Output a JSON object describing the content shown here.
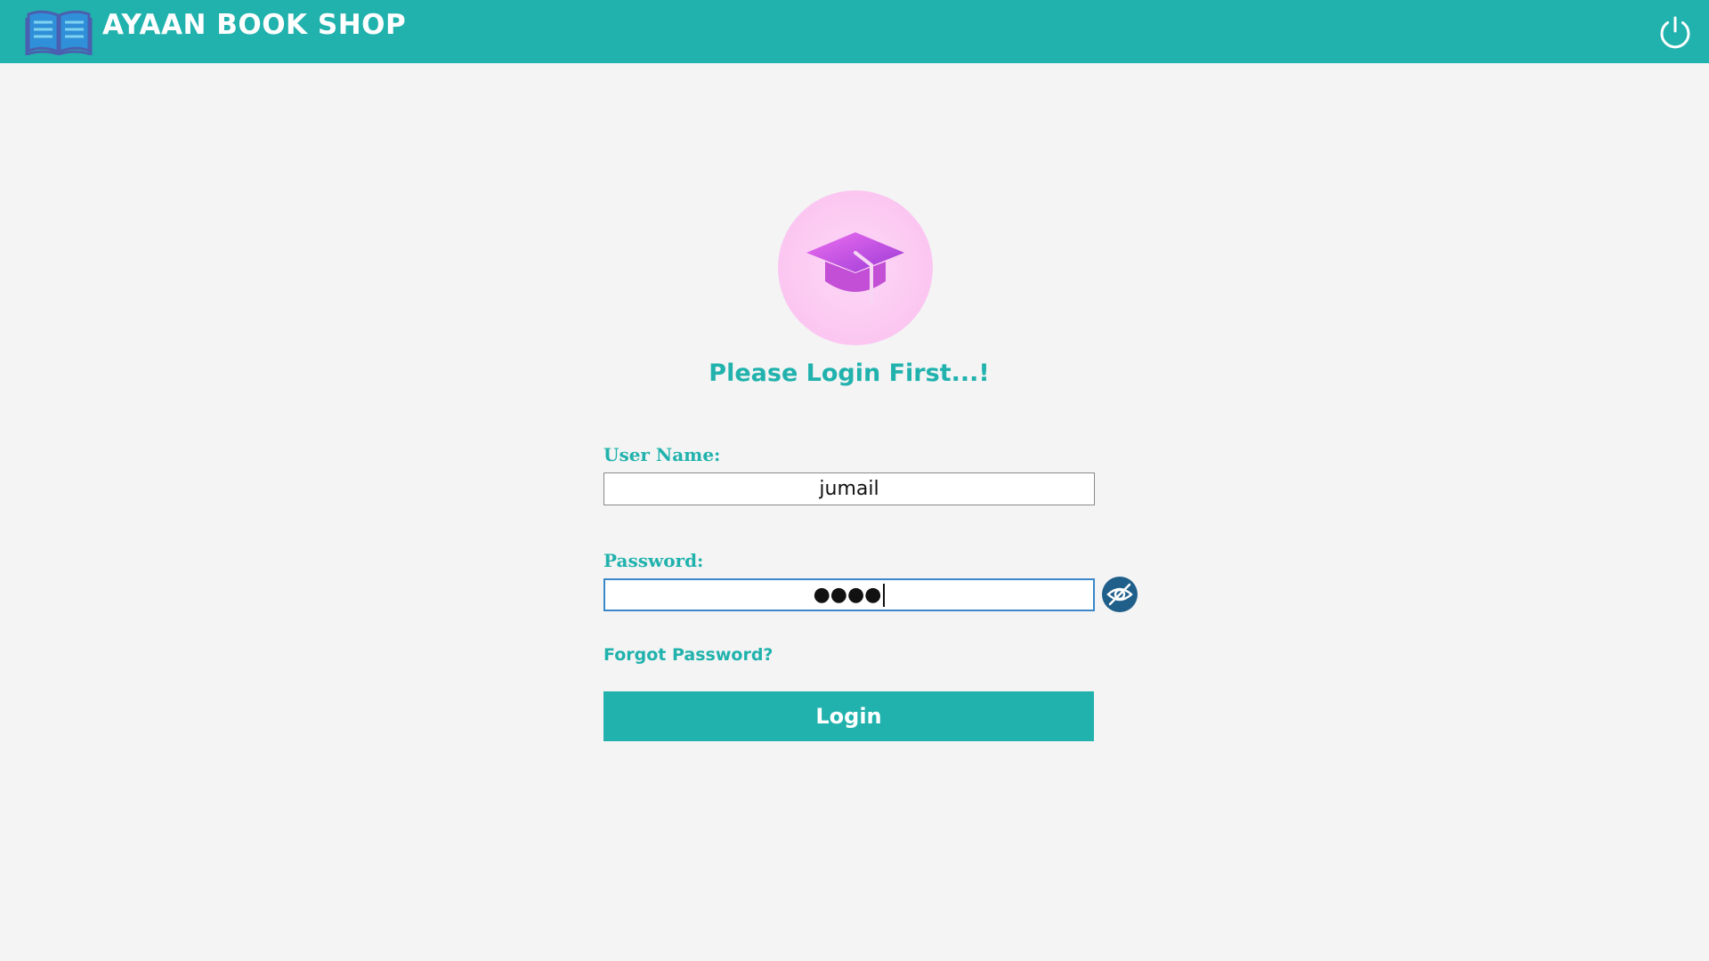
{
  "header": {
    "title": "AYAAN BOOK SHOP",
    "logo_icon": "open-book-icon",
    "power_icon": "power-icon",
    "background": "#21b2ad"
  },
  "login": {
    "avatar_icon": "graduation-cap-icon",
    "heading": "Please Login First...!",
    "username_label": "User Name:",
    "username_value": "jumail",
    "password_label": "Password:",
    "password_masked": "●●●●",
    "toggle_visibility_icon": "eye-slash-icon",
    "forgot_password": "Forgot Password?",
    "login_button": "Login",
    "accent": "#21b2ad"
  }
}
